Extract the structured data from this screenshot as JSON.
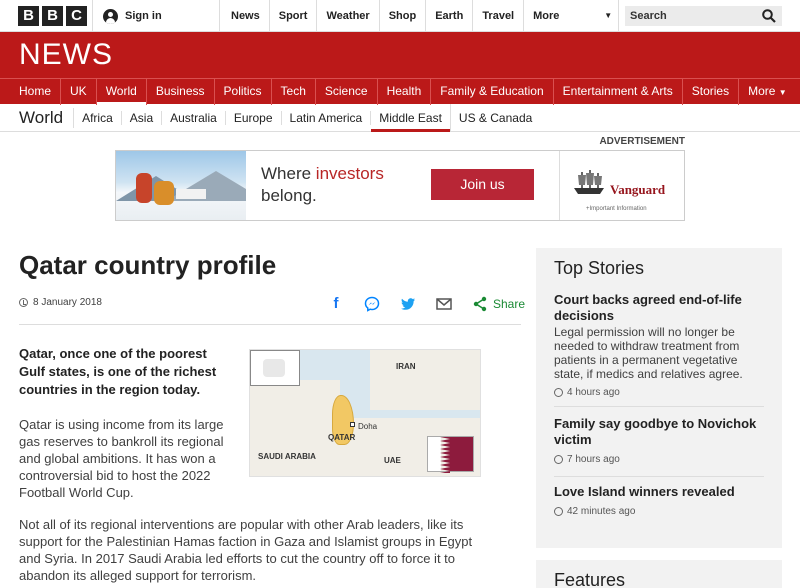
{
  "brand": {
    "logo_letters": [
      "B",
      "B",
      "C"
    ],
    "news_word": "NEWS"
  },
  "topbar": {
    "signin_label": "Sign in",
    "nav": [
      "News",
      "Sport",
      "Weather",
      "Shop",
      "Earth",
      "Travel"
    ],
    "more_label": "More",
    "search_placeholder": "Search"
  },
  "mainnav": {
    "items": [
      "Home",
      "UK",
      "World",
      "Business",
      "Politics",
      "Tech",
      "Science",
      "Health",
      "Family & Education",
      "Entertainment & Arts",
      "Stories"
    ],
    "more_label": "More",
    "active": "World"
  },
  "subnav": {
    "section": "World",
    "items": [
      "Africa",
      "Asia",
      "Australia",
      "Europe",
      "Latin America",
      "Middle East",
      "US & Canada"
    ],
    "active": "Middle East"
  },
  "ad": {
    "label": "ADVERTISEMENT",
    "text_line1_a": "Where ",
    "text_line1_b": "investors",
    "text_line2": "belong.",
    "cta": "Join us",
    "brand": "Vanguard",
    "fine_print": "+Important Information"
  },
  "article": {
    "headline": "Qatar country profile",
    "date": "8 January 2018",
    "share_label": "Share",
    "intro": "Qatar, once one of the poorest Gulf states, is one of the richest countries in the region today.",
    "para1": "Qatar is using income from its large gas reserves to bankroll its regional and global ambitions. It has won a controversial bid to host the 2022 Football World Cup.",
    "para2": "Not all of its regional interventions are popular with other Arab leaders, like its support for the Palestinian Hamas faction in Gaza and Islamist groups in Egypt and Syria. In 2017 Saudi Arabia led efforts to cut the country off to force it to abandon its alleged support for terrorism."
  },
  "map": {
    "labels": {
      "iran": "IRAN",
      "doha": "Doha",
      "qatar": "QATAR",
      "saudi": "SAUDI ARABIA",
      "uae": "UAE"
    },
    "flag_colors": {
      "white": "#ffffff",
      "maroon": "#8d1b3d"
    }
  },
  "sidebar": {
    "title": "Top Stories",
    "stories": [
      {
        "title": "Court backs agreed end-of-life decisions",
        "summary": "Legal permission will no longer be needed to withdraw treatment from patients in a permanent vegetative state, if medics and relatives agree.",
        "time": "4 hours ago"
      },
      {
        "title": "Family say goodbye to Novichok victim",
        "summary": "",
        "time": "7 hours ago"
      },
      {
        "title": "Love Island winners revealed",
        "summary": "",
        "time": "42 minutes ago"
      }
    ],
    "features_title": "Features"
  },
  "colors": {
    "bbc_red": "#bb1919",
    "share_green": "#1a8a34",
    "ad_red": "#b82636",
    "vanguard_red": "#96151d"
  }
}
